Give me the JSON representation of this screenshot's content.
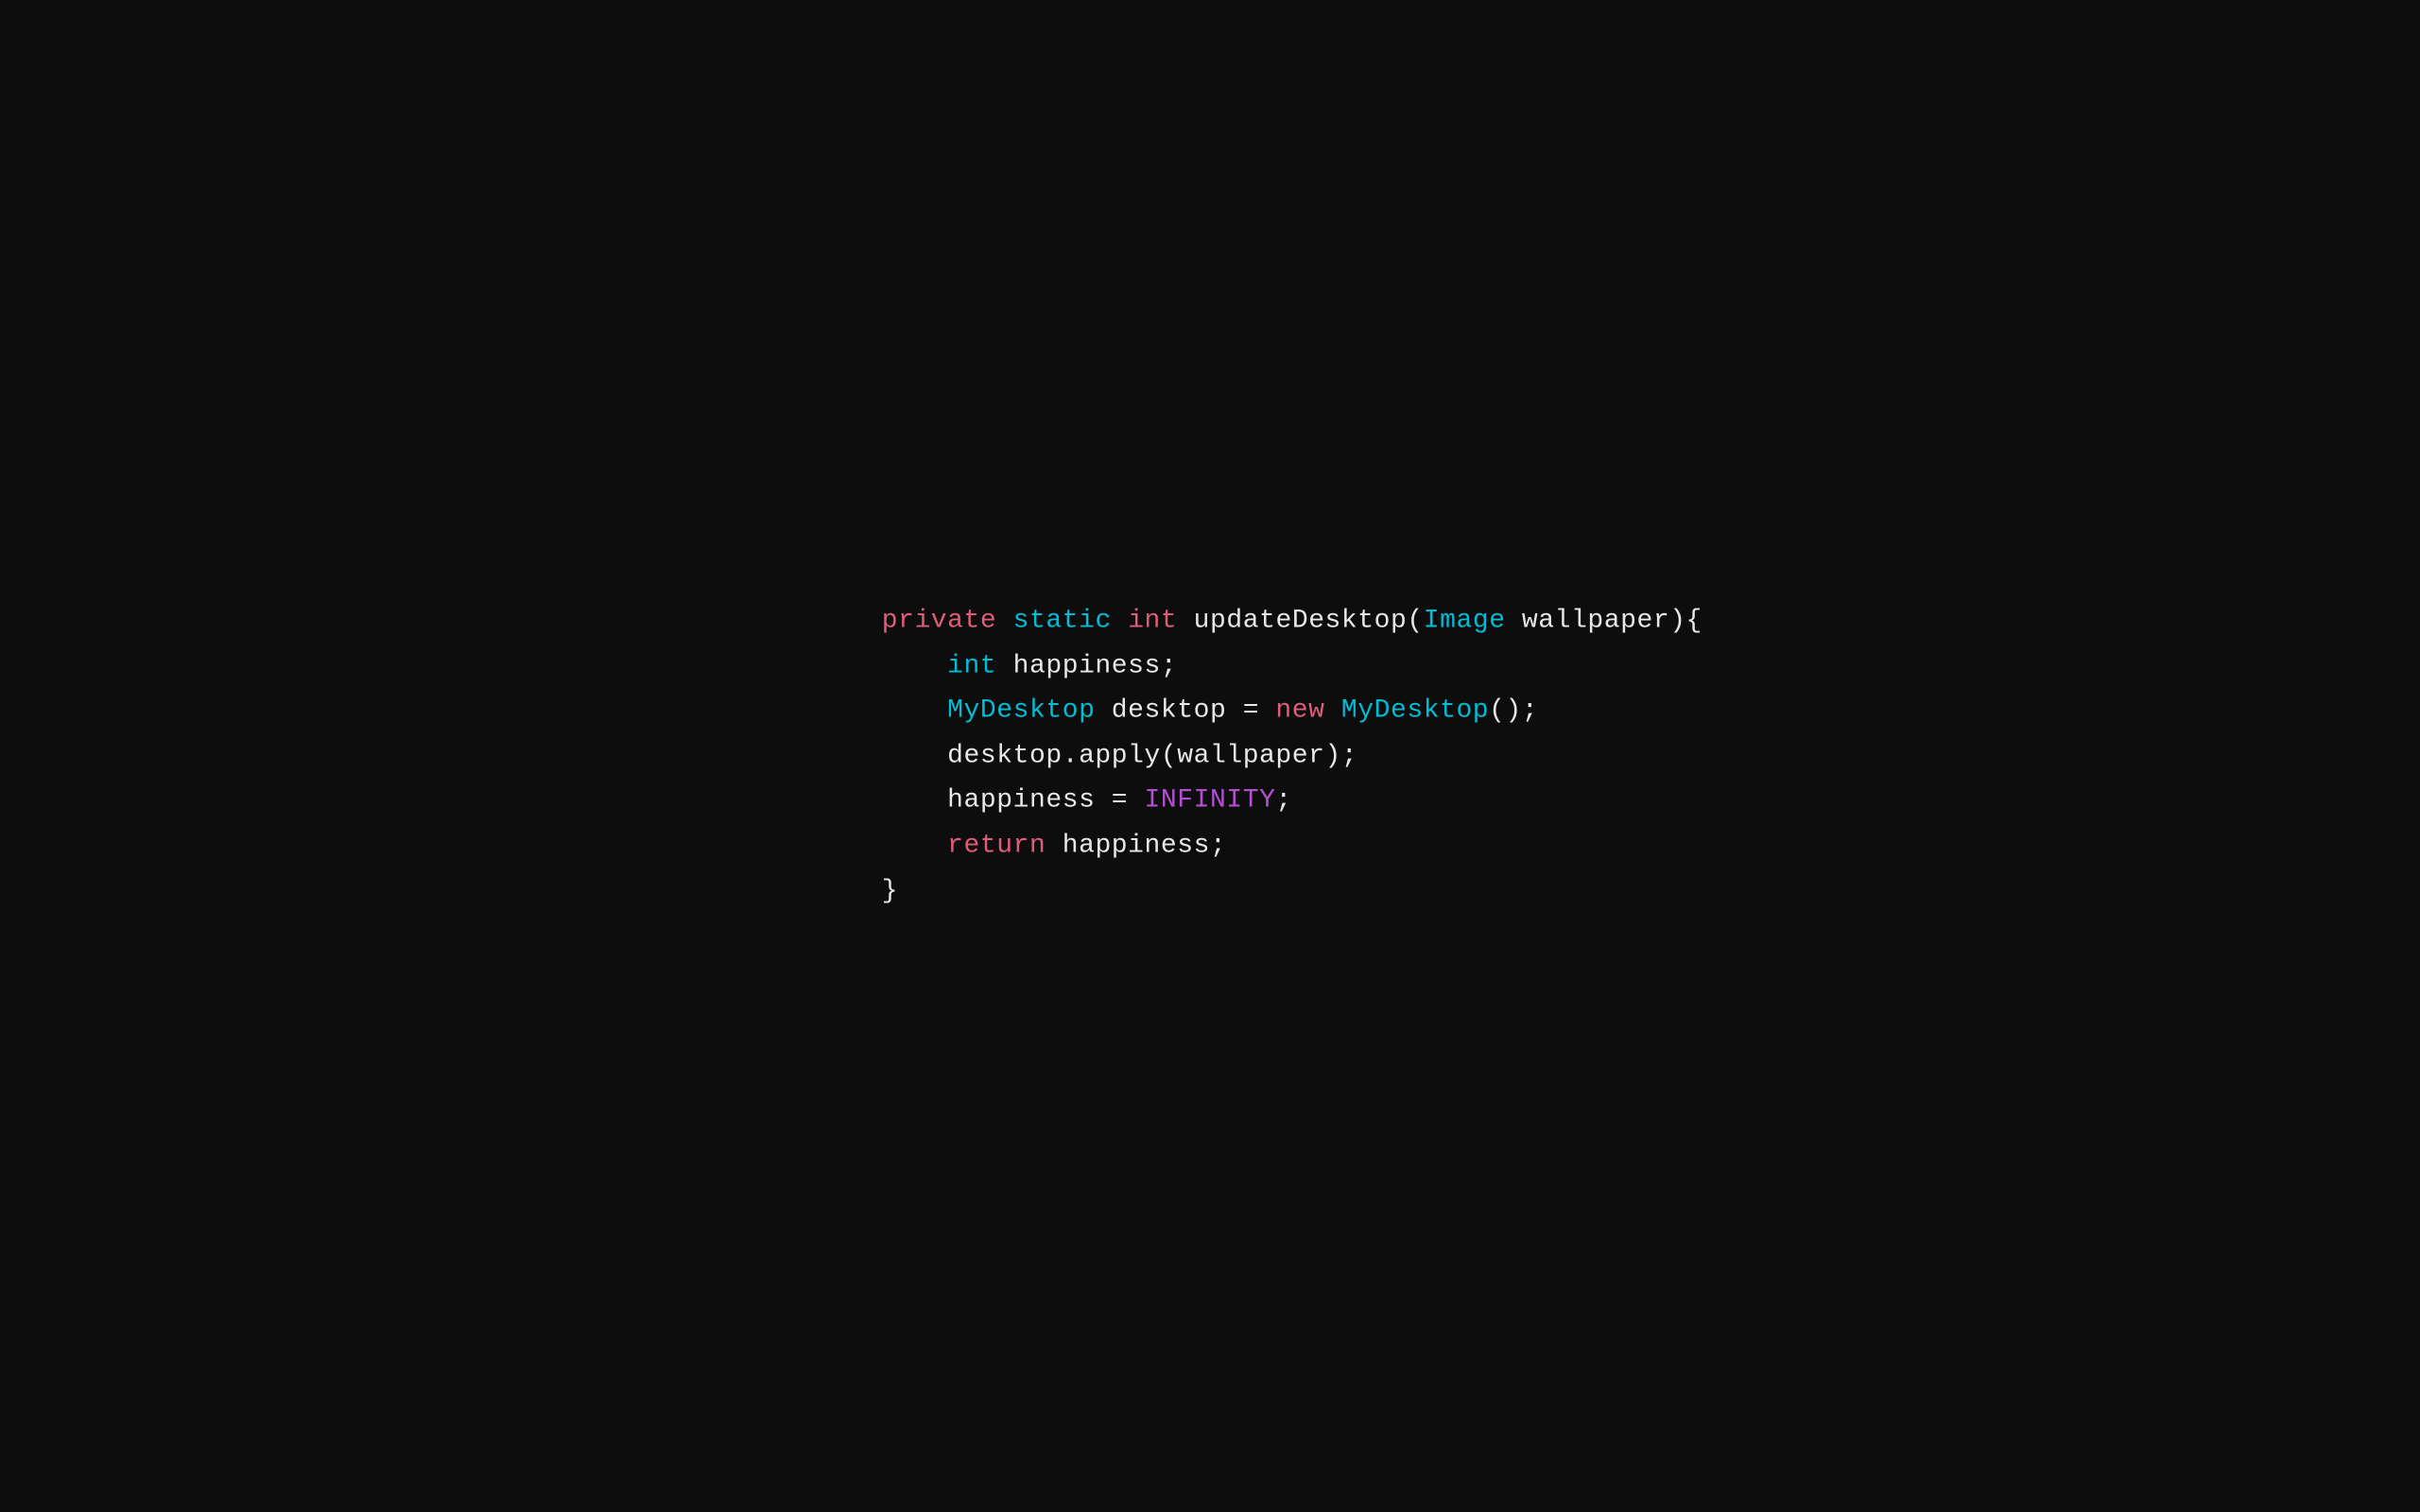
{
  "code": {
    "background": "#0d0d0d",
    "lines": [
      {
        "id": "line1",
        "parts": [
          {
            "text": "private",
            "class": "keyword-private"
          },
          {
            "text": " ",
            "class": "plain"
          },
          {
            "text": "static",
            "class": "keyword-static"
          },
          {
            "text": " ",
            "class": "plain"
          },
          {
            "text": "int",
            "class": "keyword-int"
          },
          {
            "text": " updateDesktop(",
            "class": "plain"
          },
          {
            "text": "Image",
            "class": "class-image"
          },
          {
            "text": " wallpaper){",
            "class": "plain"
          }
        ]
      },
      {
        "id": "line2",
        "parts": [
          {
            "text": "    ",
            "class": "plain"
          },
          {
            "text": "int",
            "class": "type-int"
          },
          {
            "text": " happiness;",
            "class": "plain"
          }
        ]
      },
      {
        "id": "line3",
        "parts": [
          {
            "text": "    ",
            "class": "plain"
          },
          {
            "text": "MyDesktop",
            "class": "class-mydesktop"
          },
          {
            "text": " desktop = ",
            "class": "plain"
          },
          {
            "text": "new",
            "class": "keyword-new"
          },
          {
            "text": " ",
            "class": "plain"
          },
          {
            "text": "MyDesktop",
            "class": "class-mydesktop"
          },
          {
            "text": "();",
            "class": "plain"
          }
        ]
      },
      {
        "id": "line4",
        "parts": [
          {
            "text": "    desktop.apply(wallpaper);",
            "class": "plain"
          }
        ]
      },
      {
        "id": "line5",
        "parts": [
          {
            "text": "    happiness = ",
            "class": "plain"
          },
          {
            "text": "INFINITY",
            "class": "constant"
          },
          {
            "text": ";",
            "class": "plain"
          }
        ]
      },
      {
        "id": "line6",
        "parts": [
          {
            "text": "    ",
            "class": "plain"
          },
          {
            "text": "return",
            "class": "keyword-return"
          },
          {
            "text": " happiness;",
            "class": "plain"
          }
        ]
      },
      {
        "id": "line7",
        "parts": [
          {
            "text": "}",
            "class": "closing-brace"
          }
        ]
      }
    ]
  }
}
